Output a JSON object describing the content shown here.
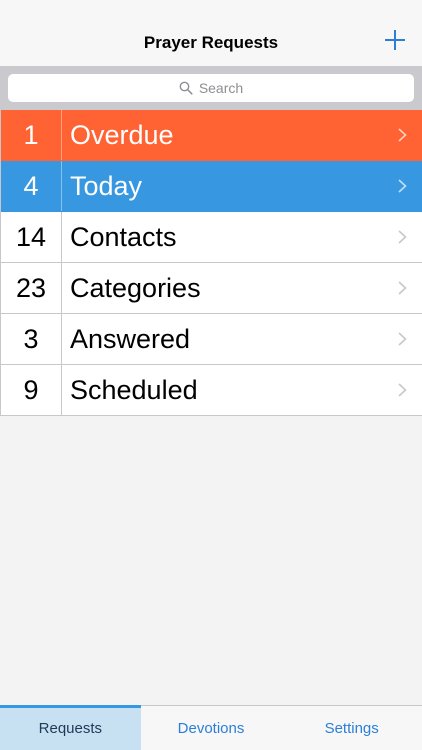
{
  "navbar": {
    "title": "Prayer Requests",
    "add_icon": "plus-icon"
  },
  "search": {
    "placeholder": "Search",
    "icon": "search-icon"
  },
  "list": {
    "rows": [
      {
        "count": "1",
        "label": "Overdue",
        "color": "#ff6233"
      },
      {
        "count": "4",
        "label": "Today",
        "color": "#3797e0"
      },
      {
        "count": "14",
        "label": "Contacts"
      },
      {
        "count": "23",
        "label": "Categories"
      },
      {
        "count": "3",
        "label": "Answered"
      },
      {
        "count": "9",
        "label": "Scheduled"
      }
    ]
  },
  "tabbar": {
    "tabs": [
      {
        "label": "Requests",
        "active": true
      },
      {
        "label": "Devotions"
      },
      {
        "label": "Settings"
      }
    ]
  },
  "colors": {
    "accent": "#2c7fd6",
    "active_tab_bg": "#c8e1f2"
  }
}
